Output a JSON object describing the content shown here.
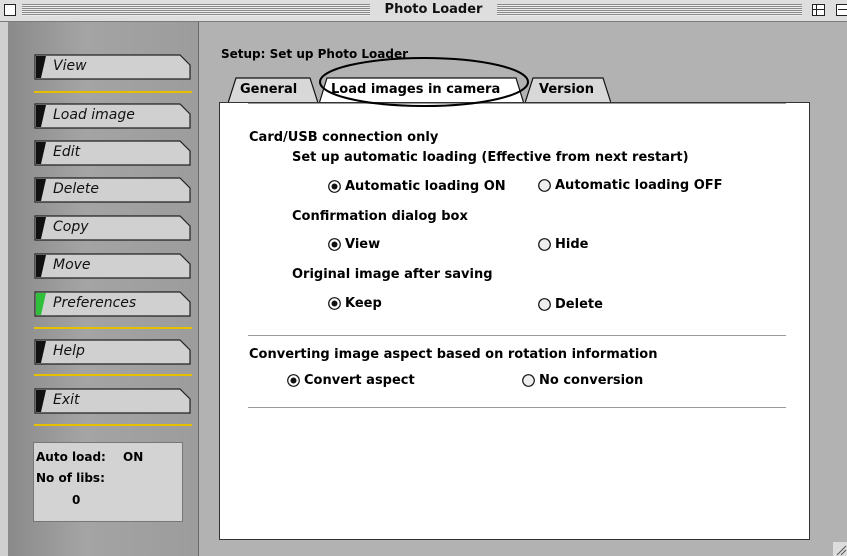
{
  "window": {
    "title": "Photo Loader"
  },
  "sidebar": {
    "buttons": [
      "View",
      "Load image",
      "Edit",
      "Delete",
      "Copy",
      "Move",
      "Preferences",
      "Help",
      "Exit"
    ],
    "status": {
      "auto_load_label": "Auto load:",
      "auto_load_value": "ON",
      "libs_label": "No of libs:",
      "libs_value": "0"
    }
  },
  "main": {
    "setup_title": "Setup: Set up Photo Loader",
    "tabs": [
      "General",
      "Load images in camera",
      "Version"
    ],
    "active_tab": "Load images in camera"
  },
  "content": {
    "section1_title": "Card/USB connection only",
    "auto_heading": "Set up automatic loading (Effective from next restart)",
    "auto_on": "Automatic loading ON",
    "auto_off": "Automatic loading OFF",
    "confirm_heading": "Confirmation dialog box",
    "confirm_view": "View",
    "confirm_hide": "Hide",
    "original_heading": "Original image after saving",
    "original_keep": "Keep",
    "original_delete": "Delete",
    "section2_title": "Converting image aspect based on rotation information",
    "convert_aspect": "Convert aspect",
    "no_conversion": "No conversion"
  },
  "colors": {
    "separator": "#e6c000",
    "active_indicator": "#2fbf3a",
    "sidebar": "#9c9c9c"
  }
}
